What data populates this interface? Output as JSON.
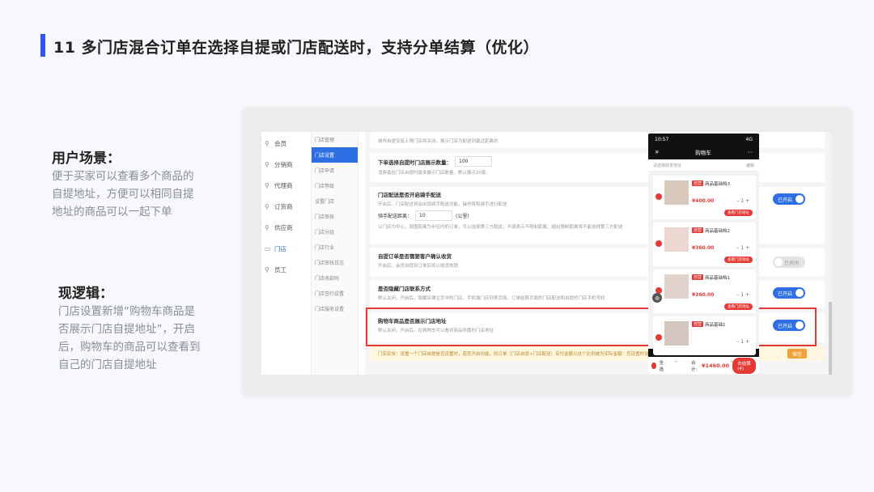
{
  "slide": {
    "title": "11 多门店混合订单在选择自提或门店配送时，支持分单结算（优化）"
  },
  "scenario": {
    "heading": "用户场景：",
    "body": "便于买家可以查看多个商品的自提地址，方便可以相同自提地址的商品可以一起下单"
  },
  "logic": {
    "heading": "现逻辑：",
    "body": "门店设置新增“购物车商品是否展示门店自提地址”，开启后，购物车的商品可以查看到自己的门店自提地址"
  },
  "admin": {
    "left_nav": [
      {
        "label": "会员",
        "icon": "user-icon",
        "active": false
      },
      {
        "label": "分销商",
        "icon": "share-icon",
        "active": false
      },
      {
        "label": "代理商",
        "icon": "agent-icon",
        "active": false
      },
      {
        "label": "订货商",
        "icon": "order-icon",
        "active": false
      },
      {
        "label": "供应商",
        "icon": "supplier-icon",
        "active": false
      },
      {
        "label": "门店",
        "icon": "store-icon",
        "active": true
      },
      {
        "label": "员工",
        "icon": "staff-icon",
        "active": false
      }
    ],
    "sub_nav": [
      {
        "label": "门店管理",
        "active": false
      },
      {
        "label": "门店设置",
        "active": true
      },
      {
        "label": "门店申请",
        "active": false
      },
      {
        "label": "门店等级",
        "active": false
      },
      {
        "label": "设置门店",
        "active": false
      },
      {
        "label": "门店审核",
        "active": false
      },
      {
        "label": "门店分组",
        "active": false
      },
      {
        "label": "门店行业",
        "active": false
      },
      {
        "label": "门店审核日志",
        "active": false
      },
      {
        "label": "门店收款码",
        "active": false
      },
      {
        "label": "门店签约设置",
        "active": false
      },
      {
        "label": "门店服务设置",
        "active": false
      }
    ],
    "top_desc": "城市自提没有上限门店将关闭，展示门店为配送到最远距离的",
    "card1": {
      "title": "下单选择自提时门店展示数量：",
      "value": "100",
      "desc": "消费者在门店自提时最多展示门店数量，默认展示20家。"
    },
    "card2": {
      "title": "门店配送是否开启骑手配送",
      "desc": "开启后，门店配送将会出现骑手配送功能，操作将和骑手进行配送",
      "range_label": "骑手配送距离：",
      "range_value": "10",
      "unit": "(公里)",
      "note": "以门店为中心，周围距离为半径内的订单，可以选择第三方配送；不填表示不限制距离；超出限制距离将不能选择第三方配送"
    },
    "card3": {
      "title": "自提订单是否需要客户确认收货",
      "desc": "开启后，会员自提到订单后将以收货核销"
    },
    "card4": {
      "title": "是否隐藏门店联系方式",
      "desc": "默认关闭，开启后，隐藏店铺主页中的门店、手机端门店列表页面、订单结算页面的门店配送和自提的门店手机号码"
    },
    "card5": {
      "title": "购物车商品是否展示门店地址",
      "desc": "默认关闭，开启后，在购物车可以看到商品所属的门店地址"
    },
    "toggle_on": "已开启",
    "toggle_off": "已关闭",
    "notice": "门店实效：设置一个门店自提是否设置时，若您开启功能，则订单（门店自提+门店配送）实付金额以这个比例被为实际金额：您设置时设置的门店",
    "save": "保存"
  },
  "phone": {
    "time": "10:57",
    "signal": "4G",
    "title": "购物车",
    "address_hint": "请选择收货地址",
    "edit": "编辑",
    "items": [
      {
        "tag": "自营",
        "name": "商品基础档3",
        "price": "¥400.00",
        "qty": "1",
        "btn": "查看门店地址"
      },
      {
        "tag": "自营",
        "name": "商品基础档2",
        "price": "¥360.00",
        "qty": "1",
        "btn": "查看门店地址"
      },
      {
        "tag": "自营",
        "name": "商品基础档1",
        "price": "¥360.00",
        "qty": "1",
        "btn": "查看门店地址"
      },
      {
        "tag": "自营",
        "name": "商品基础1",
        "price": "",
        "qty": "1",
        "btn": ""
      }
    ],
    "select_all": "全选",
    "total_label": "合计:",
    "total_amount": "¥1460.00",
    "checkout": "去结算(4)",
    "shipping_note": "不含运费"
  }
}
